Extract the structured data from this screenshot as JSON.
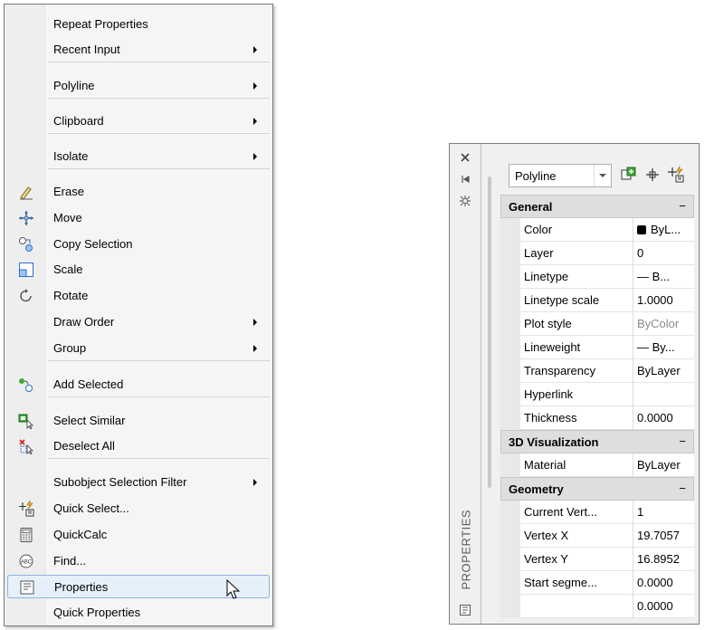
{
  "context_menu": {
    "items": [
      {
        "label": "Repeat Properties",
        "icon": "",
        "submenu": false
      },
      {
        "label": "Recent Input",
        "icon": "",
        "submenu": true
      },
      {
        "label": "Polyline",
        "icon": "",
        "submenu": true
      },
      {
        "label": "Clipboard",
        "icon": "",
        "submenu": true
      },
      {
        "label": "Isolate",
        "icon": "",
        "submenu": true
      },
      {
        "label": "Erase",
        "icon": "eraser-icon",
        "submenu": false
      },
      {
        "label": "Move",
        "icon": "move-icon",
        "submenu": false
      },
      {
        "label": "Copy Selection",
        "icon": "copy-icon",
        "submenu": false
      },
      {
        "label": "Scale",
        "icon": "scale-icon",
        "submenu": false
      },
      {
        "label": "Rotate",
        "icon": "rotate-icon",
        "submenu": false
      },
      {
        "label": "Draw Order",
        "icon": "",
        "submenu": true
      },
      {
        "label": "Group",
        "icon": "",
        "submenu": true
      },
      {
        "label": "Add Selected",
        "icon": "add-selected-icon",
        "submenu": false
      },
      {
        "label": "Select Similar",
        "icon": "select-similar-icon",
        "submenu": false
      },
      {
        "label": "Deselect All",
        "icon": "deselect-all-icon",
        "submenu": false
      },
      {
        "label": "Subobject Selection Filter",
        "icon": "",
        "submenu": true
      },
      {
        "label": "Quick Select...",
        "icon": "quick-select-icon",
        "submenu": false
      },
      {
        "label": "QuickCalc",
        "icon": "calculator-icon",
        "submenu": false
      },
      {
        "label": "Find...",
        "icon": "find-icon",
        "submenu": false
      },
      {
        "label": "Properties",
        "icon": "properties-icon",
        "submenu": false,
        "highlighted": true
      },
      {
        "label": "Quick Properties",
        "icon": "",
        "submenu": false
      }
    ]
  },
  "properties_palette": {
    "title": "PROPERTIES",
    "object_type": "Polyline",
    "toolbar_icons": [
      "toggle-pickadd-icon",
      "select-objects-icon",
      "quick-select-icon"
    ],
    "side_icons": [
      "close-icon",
      "auto-hide-icon",
      "settings-icon",
      "properties-icon"
    ],
    "categories": [
      {
        "name": "General",
        "toggle": "−",
        "rows": [
          {
            "name": "Color",
            "value": "ByL...",
            "swatch": true
          },
          {
            "name": "Layer",
            "value": "0"
          },
          {
            "name": "Linetype",
            "value": "— B..."
          },
          {
            "name": "Linetype scale",
            "value": "1.0000"
          },
          {
            "name": "Plot style",
            "value": "ByColor",
            "gray": true
          },
          {
            "name": "Lineweight",
            "value": "— By..."
          },
          {
            "name": "Transparency",
            "value": "ByLayer"
          },
          {
            "name": "Hyperlink",
            "value": ""
          },
          {
            "name": "Thickness",
            "value": "0.0000"
          }
        ]
      },
      {
        "name": "3D Visualization",
        "toggle": "−",
        "rows": [
          {
            "name": "Material",
            "value": "ByLayer"
          }
        ]
      },
      {
        "name": "Geometry",
        "toggle": "−",
        "rows": [
          {
            "name": "Current  Vert...",
            "value": "1"
          },
          {
            "name": "Vertex X",
            "value": "19.7057"
          },
          {
            "name": "Vertex Y",
            "value": "16.8952"
          },
          {
            "name": "Start  segme...",
            "value": "0.0000"
          },
          {
            "name": "",
            "value": "0.0000"
          }
        ]
      }
    ]
  }
}
